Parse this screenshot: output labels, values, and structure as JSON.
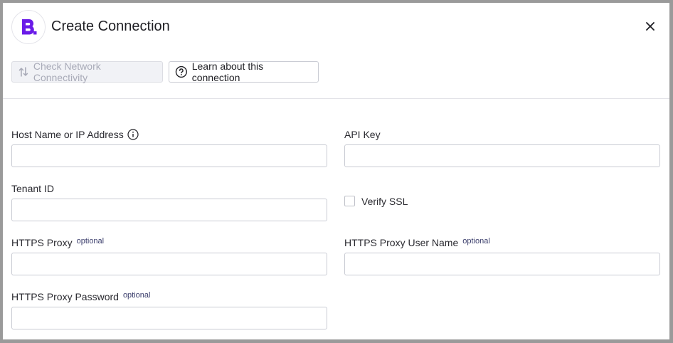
{
  "dialog": {
    "title": "Create Connection",
    "logo_icon": "brand-b-logo-icon",
    "close_icon": "close-icon"
  },
  "toolbar": {
    "check_label": "Check Network Connectivity",
    "check_icon": "network-arrows-icon",
    "learn_label": "Learn about this connection",
    "learn_icon": "question-circle-icon"
  },
  "form": {
    "host": {
      "label": "Host Name or IP Address",
      "value": "",
      "info_icon": "info-icon"
    },
    "api_key": {
      "label": "API Key",
      "value": ""
    },
    "tenant": {
      "label": "Tenant ID",
      "value": ""
    },
    "verify_ssl": {
      "label": "Verify SSL",
      "checked": false
    },
    "proxy": {
      "label": "HTTPS Proxy",
      "optional": "optional",
      "value": ""
    },
    "proxy_user": {
      "label": "HTTPS Proxy User Name",
      "optional": "optional",
      "value": ""
    },
    "proxy_password": {
      "label": "HTTPS Proxy Password",
      "optional": "optional",
      "value": ""
    }
  },
  "colors": {
    "brand": "#6a1be8",
    "disabled_text": "#a9abb8",
    "optional_text": "#3a3d6b"
  }
}
